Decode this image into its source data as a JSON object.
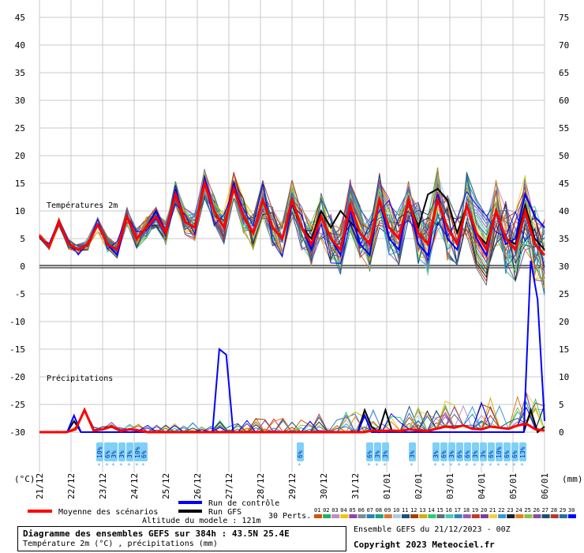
{
  "chart_data": {
    "type": "line",
    "title": "Diagramme des ensembles GEFS sur 384h : 43.5N 25.4E",
    "subtitle": "Température 2m (°C) , précipitations (mm)",
    "left_unit": "(°C)",
    "right_unit": "(mm)",
    "left_axis": {
      "ticks": [
        45,
        40,
        35,
        30,
        25,
        20,
        15,
        10,
        5,
        0,
        -5,
        -10,
        -15,
        -20,
        -25,
        -30
      ],
      "range": [
        -30,
        45
      ]
    },
    "right_axis": {
      "ticks": [
        75,
        70,
        65,
        60,
        55,
        50,
        45,
        40,
        35,
        30,
        25,
        20,
        15,
        10,
        5,
        0
      ],
      "range": [
        0,
        75
      ]
    },
    "x_categories": [
      "21/12",
      "22/12",
      "23/12",
      "24/12",
      "25/12",
      "26/12",
      "27/12",
      "28/12",
      "29/12",
      "30/12",
      "31/12",
      "01/01",
      "02/01",
      "03/01",
      "04/01",
      "05/01",
      "06/01"
    ],
    "section_labels": {
      "temperature": "Températures 2m",
      "precipitation": "Précipitations"
    },
    "series": [
      {
        "name": "Moyenne des scénarios",
        "color": "#ff0000",
        "temperature": [
          5.5,
          3.5,
          8,
          4,
          3,
          4,
          7.5,
          4,
          3,
          9,
          5,
          7,
          9,
          6,
          13,
          8,
          7,
          15,
          10,
          7,
          14,
          9,
          6,
          12,
          7,
          5,
          12,
          7,
          4,
          9,
          5,
          3,
          11,
          6,
          4,
          12,
          7,
          5,
          12,
          6,
          4,
          12,
          7,
          4,
          11,
          6,
          3,
          10,
          5,
          3,
          10,
          4,
          2
        ],
        "precip": [
          0,
          0,
          0,
          0,
          0.5,
          4,
          0.3,
          0.5,
          1,
          0.2,
          0.5,
          0.3,
          0,
          0,
          0,
          0,
          0,
          0,
          0,
          0,
          0,
          0,
          0,
          0,
          0,
          0,
          0,
          0,
          0,
          0,
          0,
          0,
          0,
          0,
          0,
          0,
          0,
          0.3,
          0.2,
          0.3,
          0.2,
          0.5,
          0.3,
          0.2,
          0.6,
          1,
          0.8,
          1.2,
          0.6,
          0.5,
          1,
          0.8,
          0.6,
          1.2,
          1.5,
          0.5,
          0.3
        ]
      },
      {
        "name": "Run de contrôle",
        "color": "#0000ff",
        "temperature": [
          5.5,
          3.5,
          8,
          4,
          3,
          4,
          7.5,
          4,
          2,
          9,
          5,
          7,
          10,
          6,
          14,
          8,
          7,
          16,
          10,
          7,
          15,
          9,
          6,
          12,
          7,
          5,
          12,
          7,
          3,
          9,
          5,
          2,
          10,
          4,
          2,
          12,
          5,
          3,
          12,
          4,
          2,
          13,
          5,
          3,
          11,
          5,
          2,
          10,
          4,
          5,
          13,
          9,
          7
        ],
        "precip": [
          0,
          0,
          0,
          0,
          0,
          3,
          0,
          0,
          0,
          0,
          0,
          0,
          0,
          0,
          0,
          0,
          0,
          0,
          0,
          0,
          0,
          0,
          0,
          0,
          0,
          0,
          15,
          14,
          0,
          0,
          0,
          0,
          0,
          0,
          0,
          0,
          0,
          0,
          0,
          0,
          0,
          0,
          0,
          0,
          0,
          0,
          0,
          3,
          0,
          0,
          0,
          0,
          0,
          0,
          0,
          0,
          0,
          0,
          0,
          0,
          0,
          0,
          0,
          0,
          0,
          0,
          0,
          0,
          0,
          0,
          0,
          31,
          24,
          2
        ]
      },
      {
        "name": "Run GFS",
        "color": "#000000",
        "temperature": [
          5.5,
          3.5,
          8,
          4,
          3,
          4,
          7.5,
          4,
          3,
          9,
          5,
          7,
          10,
          6,
          13,
          8,
          7,
          15,
          10,
          7,
          14,
          9,
          6,
          12,
          7,
          5,
          12,
          7,
          5,
          10,
          7,
          10,
          8,
          6,
          4,
          12,
          7,
          5,
          12,
          7,
          13,
          14,
          12,
          6,
          11,
          6,
          4,
          10,
          5,
          4,
          11,
          5,
          3
        ],
        "precip": [
          0,
          0,
          0,
          0,
          0,
          2,
          0,
          0,
          0,
          0,
          0,
          0,
          0,
          0,
          0,
          0,
          0,
          0,
          0,
          0,
          0,
          0,
          0,
          0,
          0,
          0,
          0,
          0,
          0,
          0,
          0,
          0,
          0,
          0,
          0,
          0,
          0,
          0,
          0,
          0,
          0,
          0,
          0,
          0,
          0,
          0,
          0,
          4,
          1,
          0,
          4,
          0,
          0,
          0,
          0,
          0,
          0,
          0,
          0,
          0,
          0,
          0,
          0,
          0,
          0,
          0,
          0,
          0,
          0,
          0,
          0,
          4,
          0,
          1
        ]
      }
    ],
    "snow_markers": [
      {
        "day": 1.9,
        "label": "10%"
      },
      {
        "day": 2.15,
        "label": "6%"
      },
      {
        "day": 2.35,
        "label": "3%"
      },
      {
        "day": 2.6,
        "label": "3%"
      },
      {
        "day": 2.85,
        "label": "3%"
      },
      {
        "day": 3.1,
        "label": "10%"
      },
      {
        "day": 3.3,
        "label": "6%"
      },
      {
        "day": 8.25,
        "label": "6%"
      },
      {
        "day": 10.45,
        "label": "6%"
      },
      {
        "day": 10.7,
        "label": "3%"
      },
      {
        "day": 10.95,
        "label": "3%"
      },
      {
        "day": 11.8,
        "label": "3%"
      },
      {
        "day": 12.55,
        "label": "3%"
      },
      {
        "day": 12.8,
        "label": "6%"
      },
      {
        "day": 13.05,
        "label": "3%"
      },
      {
        "day": 13.3,
        "label": "6%"
      },
      {
        "day": 13.55,
        "label": "6%"
      },
      {
        "day": 13.8,
        "label": "3%"
      },
      {
        "day": 14.05,
        "label": "3%"
      },
      {
        "day": 14.3,
        "label": "6%"
      },
      {
        "day": 14.55,
        "label": "10%"
      },
      {
        "day": 14.8,
        "label": "6%"
      },
      {
        "day": 15.05,
        "label": "6%"
      },
      {
        "day": 15.3,
        "label": "13%"
      }
    ],
    "perturbations_label": "30 Perts.",
    "perturbation_ids": [
      "01",
      "02",
      "03",
      "04",
      "05",
      "06",
      "07",
      "08",
      "09",
      "10",
      "11",
      "12",
      "13",
      "14",
      "15",
      "16",
      "17",
      "18",
      "19",
      "20",
      "21",
      "22",
      "23",
      "24",
      "25",
      "26",
      "27",
      "28",
      "29",
      "30"
    ],
    "perturbation_colors": [
      "#d35400",
      "#27ae60",
      "#bb8fce",
      "#f1c40f",
      "#8e44ad",
      "#7f8c8d",
      "#2980b9",
      "#16a085",
      "#dc7633",
      "#a9cce3",
      "#1a5276",
      "#a04000",
      "#d4ac0d",
      "#2ecc71",
      "#5d6d7e",
      "#48c9b0",
      "#2e86c1",
      "#9b59b6",
      "#c0392b",
      "#7d3c98",
      "#f4d03f",
      "#3498db",
      "#17202a",
      "#e67e22",
      "#8bc34a",
      "#884ea0",
      "#1b4f72",
      "#b03a2e",
      "#2471a3",
      "#0000ff"
    ]
  },
  "footer": {
    "title": "Diagramme des ensembles GEFS sur 384h : 43.5N 25.4E",
    "subtitle": "Température 2m (°C) , précipitations (mm)",
    "altitude": "Altitude du modele : 121m",
    "ensemble_info": "Ensemble GEFS du 21/12/2023 - 00Z",
    "copyright": "Copyright 2023 Meteociel.fr"
  }
}
